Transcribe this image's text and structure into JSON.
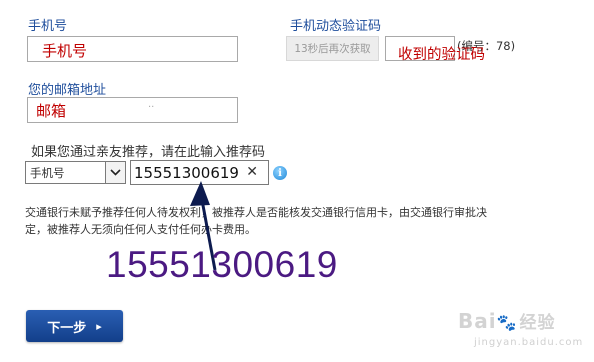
{
  "form": {
    "phone_label": "手机号",
    "phone_value": "手机号",
    "otp_label": "手机动态验证码",
    "otp_button": "13秒后再次获取",
    "otp_value": "收到的验证码",
    "otp_serial": "(编号：78)",
    "email_label": "您的邮箱地址",
    "email_value": "邮箱",
    "email_dots": "..",
    "referral_label": "如果您通过亲友推荐，请在此输入推荐码",
    "referral_type_selected": "手机号",
    "referral_value": "15551300619",
    "clear_symbol": "✕",
    "info_symbol": "i",
    "notice_line1": "交通银行未赋予推荐任何人待发权利，被推荐人是否能核发交通银行信用卡，由交通银行审批决",
    "notice_line2": "定，被推荐人无须向任何人支付任何办卡费用。",
    "next_button": "下一步",
    "next_arrow": "▸"
  },
  "annotation": {
    "big_number": "15551300619"
  },
  "watermark": {
    "text": "Bai",
    "text2": "经验",
    "text3": "jingyan.baidu.com"
  },
  "colors": {
    "label_blue": "#1f4e9c",
    "hand_red": "#c00000",
    "annotation_purple": "#4b1a82",
    "button_blue": "#1a4f9e"
  },
  "icons": {
    "info": "info-icon",
    "clear": "clear-icon",
    "dropdown": "chevron-down-icon",
    "arrow": "annotation-arrow"
  }
}
